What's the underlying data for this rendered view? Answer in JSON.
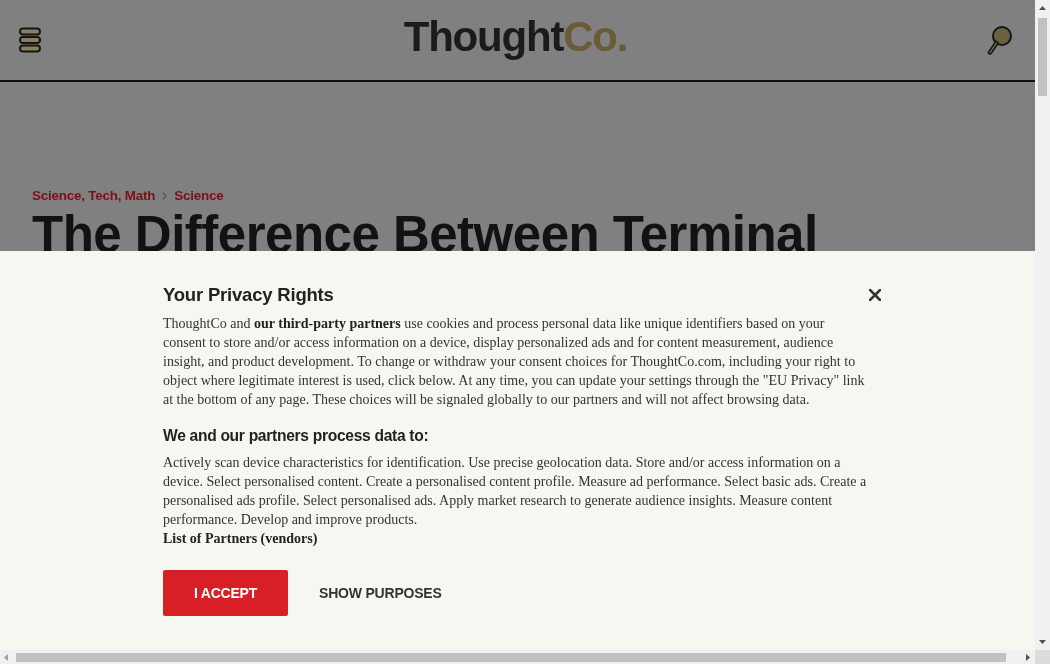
{
  "header": {
    "logo": {
      "text": "Thought",
      "accent": "Co."
    }
  },
  "breadcrumb": [
    {
      "label": "Science, Tech, Math"
    },
    {
      "label": "Science"
    }
  ],
  "article": {
    "title": "The Difference Between Terminal"
  },
  "consent_dialog": {
    "title": "Your Privacy Rights",
    "intro": "ThoughtCo and **our third-party partners** use cookies and process personal data like unique identifiers based on your consent to store and/or access information on a device, display personalized ads and for content measurement, audience insight, and product development. To change or withdraw your consent choices for ThoughtCo.com, including your right to object where legitimate interest is used, click below. At any time, you can update your settings through the \"EU Privacy\" link at the bottom of any page. These choices will be signaled globally to our partners and will not affect browsing data.",
    "purposes_heading": "We and our partners process data to:",
    "purposes": "Actively scan device characteristics for identification. Use precise geolocation data. Store and/or access information on a device. Select personalised content. Create a personalised content profile. Measure ad performance. Select basic ads. Create a personalised ads profile. Select personalised ads. Apply market research to generate audience insights. Measure content performance. Develop and improve products.",
    "partners_link": "List of Partners (vendors)",
    "buttons": [
      {
        "label": "I ACCEPT",
        "kind": "primary"
      },
      {
        "label": "SHOW PURPOSES",
        "kind": "text"
      }
    ]
  }
}
